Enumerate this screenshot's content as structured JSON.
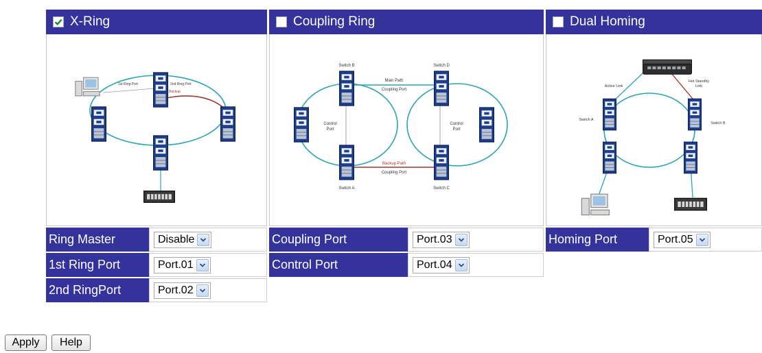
{
  "xring": {
    "title": "X-Ring",
    "enabled": true,
    "diagram": {
      "ring_port_1": "1st Ring Port",
      "ring_port_2": "2nd Ring Port",
      "backup": "Backup"
    },
    "fields": [
      {
        "label": "Ring Master",
        "value": "Disable"
      },
      {
        "label": "1st Ring Port",
        "value": "Port.01"
      },
      {
        "label": "2nd RingPort",
        "value": "Port.02"
      }
    ]
  },
  "coupling": {
    "title": "Coupling Ring",
    "enabled": false,
    "diagram": {
      "switch_b": "Switch B",
      "switch_d": "Switch D",
      "main_path": "Main Path",
      "coupling_port_top": "Coupling Port",
      "control_port_left_1": "Control",
      "control_port_left_2": "Port",
      "control_port_right_1": "Control",
      "control_port_right_2": "Port",
      "backup_path": "Backup Path",
      "coupling_port_bottom": "Coupling Port",
      "switch_a": "Switch A",
      "switch_c": "Switch C"
    },
    "fields": [
      {
        "label": "Coupling Port",
        "value": "Port.03"
      },
      {
        "label": "Control Port",
        "value": "Port.04"
      }
    ]
  },
  "homing": {
    "title": "Dual Homing",
    "enabled": false,
    "diagram": {
      "active_link": "Active Link",
      "hot_standby": "Hot Standby",
      "link": "Link",
      "switch_a": "Switch A",
      "switch_b": "Switch B"
    },
    "fields": [
      {
        "label": "Homing Port",
        "value": "Port.05"
      }
    ]
  },
  "buttons": {
    "apply": "Apply",
    "help": "Help"
  },
  "colors": {
    "header_bg": "#33339b",
    "ring_line": "#2aa3b3",
    "backup_line": "#a0362c",
    "checkmark": "#1e8a2e"
  }
}
